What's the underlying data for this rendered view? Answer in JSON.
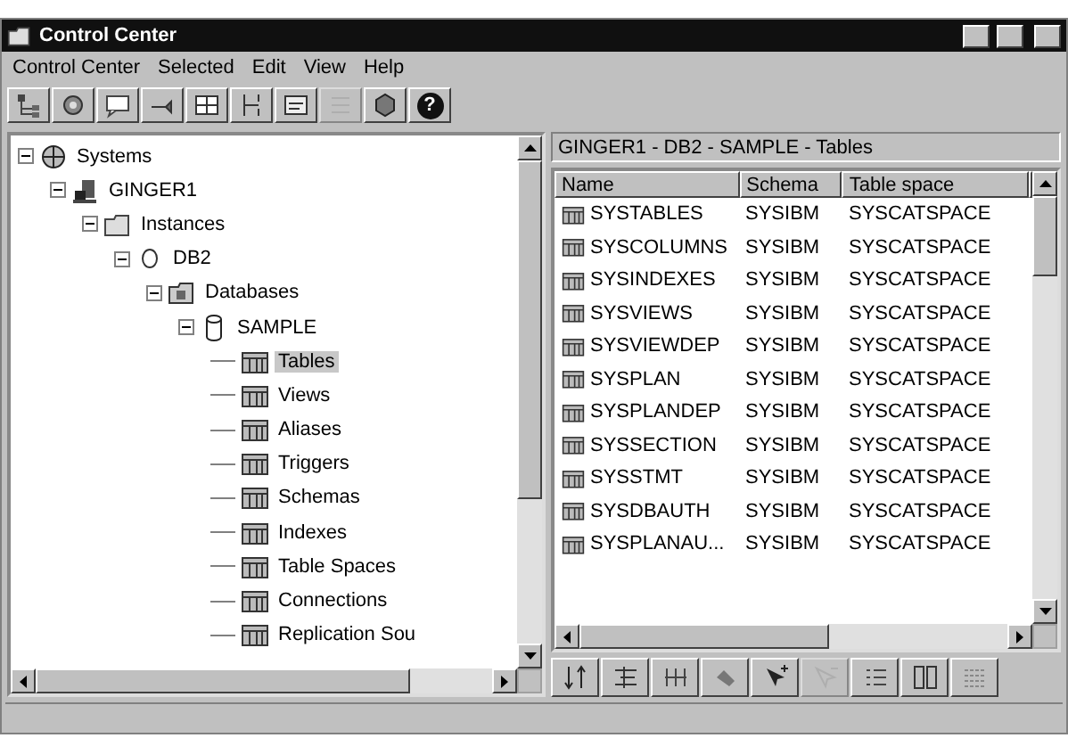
{
  "window": {
    "title": "Control Center"
  },
  "menu": [
    "Control Center",
    "Selected",
    "Edit",
    "View",
    "Help"
  ],
  "toolbar": [
    {
      "disabled": false
    },
    {
      "disabled": false
    },
    {
      "disabled": false
    },
    {
      "disabled": false
    },
    {
      "disabled": false
    },
    {
      "disabled": false
    },
    {
      "disabled": false
    },
    {
      "disabled": true
    },
    {
      "disabled": false
    },
    {
      "disabled": false,
      "label": "?"
    }
  ],
  "tree": [
    {
      "label": "Systems",
      "expanded": true,
      "selected": false,
      "children": [
        {
          "label": "GINGER1",
          "expanded": true,
          "selected": false,
          "children": [
            {
              "label": "Instances",
              "expanded": true,
              "selected": false,
              "children": [
                {
                  "label": "DB2",
                  "expanded": true,
                  "selected": false,
                  "children": [
                    {
                      "label": "Databases",
                      "expanded": true,
                      "selected": false,
                      "children": [
                        {
                          "label": "SAMPLE",
                          "expanded": true,
                          "selected": false,
                          "children": [
                            {
                              "label": "Tables",
                              "selected": true
                            },
                            {
                              "label": "Views",
                              "selected": false
                            },
                            {
                              "label": "Aliases",
                              "selected": false
                            },
                            {
                              "label": "Triggers",
                              "selected": false
                            },
                            {
                              "label": "Schemas",
                              "selected": false
                            },
                            {
                              "label": "Indexes",
                              "selected": false
                            },
                            {
                              "label": "Table Spaces",
                              "selected": false
                            },
                            {
                              "label": "Connections",
                              "selected": false
                            },
                            {
                              "label": "Replication Sou",
                              "selected": false
                            }
                          ]
                        }
                      ]
                    }
                  ]
                }
              ]
            }
          ]
        }
      ]
    }
  ],
  "detail": {
    "path": "GINGER1 - DB2 - SAMPLE - Tables",
    "columns": [
      "Name",
      "Schema",
      "Table space"
    ],
    "rows": [
      {
        "name": "SYSTABLES",
        "schema": "SYSIBM",
        "table_space": "SYSCATSPACE"
      },
      {
        "name": "SYSCOLUMNS",
        "schema": "SYSIBM",
        "table_space": "SYSCATSPACE"
      },
      {
        "name": "SYSINDEXES",
        "schema": "SYSIBM",
        "table_space": "SYSCATSPACE"
      },
      {
        "name": "SYSVIEWS",
        "schema": "SYSIBM",
        "table_space": "SYSCATSPACE"
      },
      {
        "name": "SYSVIEWDEP",
        "schema": "SYSIBM",
        "table_space": "SYSCATSPACE"
      },
      {
        "name": "SYSPLAN",
        "schema": "SYSIBM",
        "table_space": "SYSCATSPACE"
      },
      {
        "name": "SYSPLANDEP",
        "schema": "SYSIBM",
        "table_space": "SYSCATSPACE"
      },
      {
        "name": "SYSSECTION",
        "schema": "SYSIBM",
        "table_space": "SYSCATSPACE"
      },
      {
        "name": "SYSSTMT",
        "schema": "SYSIBM",
        "table_space": "SYSCATSPACE"
      },
      {
        "name": "SYSDBAUTH",
        "schema": "SYSIBM",
        "table_space": "SYSCATSPACE"
      },
      {
        "name": "SYSPLANAU...",
        "schema": "SYSIBM",
        "table_space": "SYSCATSPACE"
      }
    ]
  },
  "bottom_toolbar": [
    {
      "disabled": false
    },
    {
      "disabled": false
    },
    {
      "disabled": false
    },
    {
      "disabled": false
    },
    {
      "disabled": false
    },
    {
      "disabled": true
    },
    {
      "disabled": false
    },
    {
      "disabled": false
    },
    {
      "disabled": false
    }
  ]
}
